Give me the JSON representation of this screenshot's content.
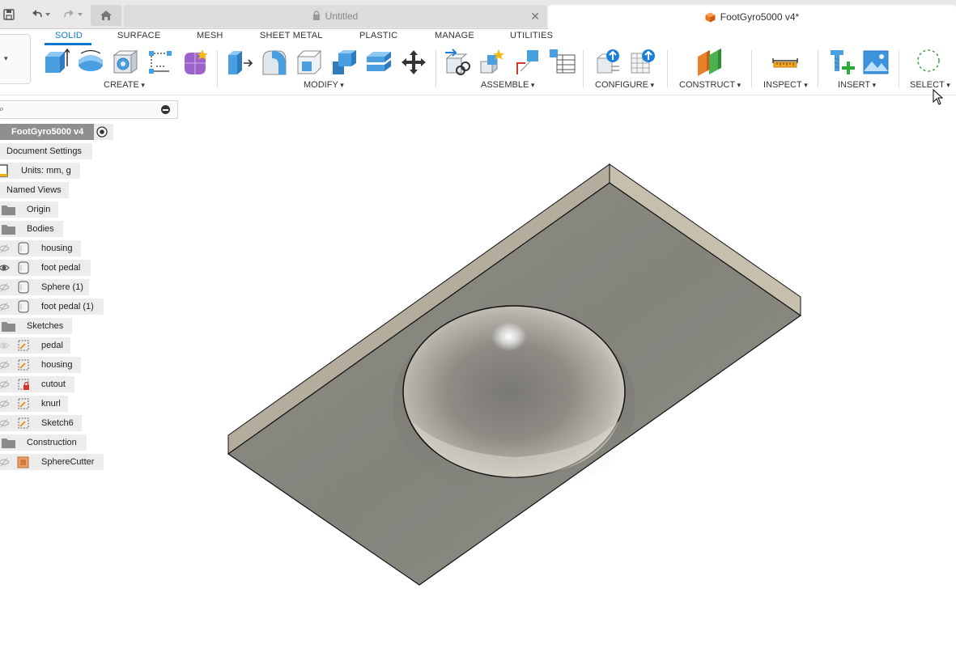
{
  "app": {
    "accent_color": "#0a78d1",
    "document_tabs": [
      {
        "label": "Untitled",
        "state": "inactive",
        "icon": "lock-icon"
      },
      {
        "label": "FootGyro5000 v4*",
        "state": "active",
        "icon": "cube-icon"
      }
    ]
  },
  "quick_access": [
    {
      "icon": "save-icon"
    },
    {
      "icon": "undo-icon"
    },
    {
      "icon": "redo-icon"
    },
    {
      "icon": "home-icon"
    }
  ],
  "ribbon": {
    "tabs": [
      {
        "label": "SOLID",
        "active": true
      },
      {
        "label": "SURFACE",
        "active": false
      },
      {
        "label": "MESH",
        "active": false
      },
      {
        "label": "SHEET METAL",
        "active": false
      },
      {
        "label": "PLASTIC",
        "active": false
      },
      {
        "label": "MANAGE",
        "active": false
      },
      {
        "label": "UTILITIES",
        "active": false
      }
    ],
    "groups": {
      "create": "CREATE",
      "modify": "MODIFY",
      "assemble": "ASSEMBLE",
      "configure": "CONFIGURE",
      "construct": "CONSTRUCT",
      "inspect": "INSPECT",
      "insert": "INSERT",
      "select": "SELECT"
    }
  },
  "browser": {
    "search_icon": "search-icon",
    "root": "FootGyro5000 v4",
    "items": {
      "document_settings": "Document Settings",
      "units": "Units: mm, g",
      "named_views": "Named Views",
      "origin": "Origin",
      "bodies": "Bodies",
      "body_housing": "housing",
      "body_foot_pedal": "foot pedal",
      "body_sphere": "Sphere (1)",
      "body_foot_pedal_1": "foot pedal (1)",
      "sketches": "Sketches",
      "sketch_pedal": "pedal",
      "sketch_housing": "housing",
      "sketch_cutout": "cutout",
      "sketch_knurl": "knurl",
      "sketch_6": "Sketch6",
      "construction": "Construction",
      "sphere_cutter": "SphereCutter"
    }
  }
}
